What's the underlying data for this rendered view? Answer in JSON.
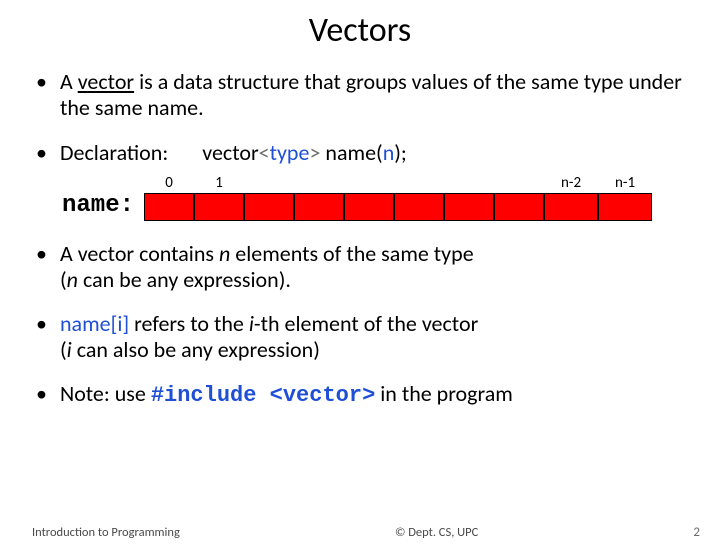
{
  "title": "Vectors",
  "bullets": {
    "b1_pre": "A ",
    "b1_vector": "vector",
    "b1_post": " is a data structure that groups values of the same type under the same name.",
    "decl_label": "Declaration:",
    "decl_v": "vector",
    "decl_lt": "<",
    "decl_type": "type",
    "decl_gt": ">",
    "decl_sp": " ",
    "decl_name": "name(",
    "decl_n": "n",
    "decl_close": ");",
    "b3_pre": "A vector contains ",
    "b3_n1": "n",
    "b3_mid": " elements of the same type ",
    "b3_paren_open": "(",
    "b3_n2": "n",
    "b3_paren_text": " can be any expression).",
    "b4_pre": "name[i]",
    "b4_mid": " refers to the ",
    "b4_i": "i",
    "b4_mid2": "-th element of the vector ",
    "b4_paren": "(",
    "b4_i2": "i",
    "b4_post": " can also be any expression)",
    "b5_pre": "Note: use   ",
    "b5_code": "#include <vector>",
    "b5_post": "   in the program"
  },
  "vector_diagram": {
    "name_label": "name:",
    "indices": [
      "0",
      "1",
      "",
      "",
      "",
      "",
      "",
      "",
      "n-2",
      "n-1"
    ],
    "cell_count": 10
  },
  "footer": {
    "left": "Introduction to Programming",
    "center": "© Dept. CS, UPC",
    "page": "2"
  }
}
